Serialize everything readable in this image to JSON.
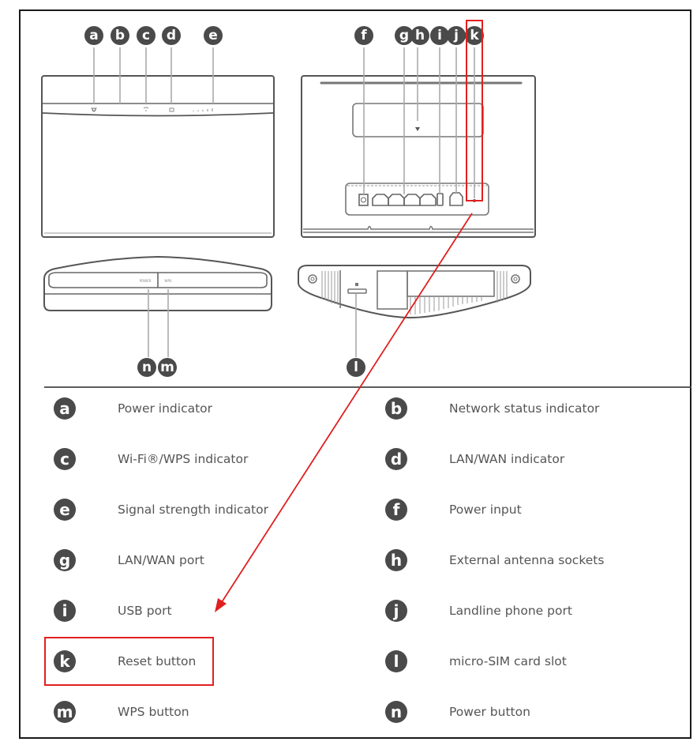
{
  "figure": {
    "views": {
      "front": {
        "leds": [
          "power-led",
          "network-led",
          "wifi-led",
          "lan-led",
          "signal-bars"
        ]
      },
      "top": {
        "button_labels": [
          "POWER",
          "WPS"
        ]
      },
      "back": {},
      "bottom": {}
    },
    "callouts": {
      "a": "a",
      "b": "b",
      "c": "c",
      "d": "d",
      "e": "e",
      "f": "f",
      "g": "g",
      "h": "h",
      "i": "i",
      "j": "j",
      "k": "k",
      "l": "l",
      "m": "m",
      "n": "n"
    },
    "highlight": {
      "color": "#e02020",
      "target_callout": "k",
      "target_legend": "Reset button"
    }
  },
  "legend": {
    "items": [
      {
        "key": "a",
        "label": "Power indicator"
      },
      {
        "key": "b",
        "label": "Network status indicator"
      },
      {
        "key": "c",
        "label": "Wi-Fi®/WPS indicator"
      },
      {
        "key": "d",
        "label": "LAN/WAN indicator"
      },
      {
        "key": "e",
        "label": "Signal strength indicator"
      },
      {
        "key": "f",
        "label": "Power input"
      },
      {
        "key": "g",
        "label": "LAN/WAN port"
      },
      {
        "key": "h",
        "label": "External antenna sockets"
      },
      {
        "key": "i",
        "label": "USB port"
      },
      {
        "key": "j",
        "label": "Landline phone port"
      },
      {
        "key": "k",
        "label": "Reset button"
      },
      {
        "key": "l",
        "label": "micro-SIM card slot"
      },
      {
        "key": "m",
        "label": "WPS button"
      },
      {
        "key": "n",
        "label": "Power button"
      }
    ]
  }
}
